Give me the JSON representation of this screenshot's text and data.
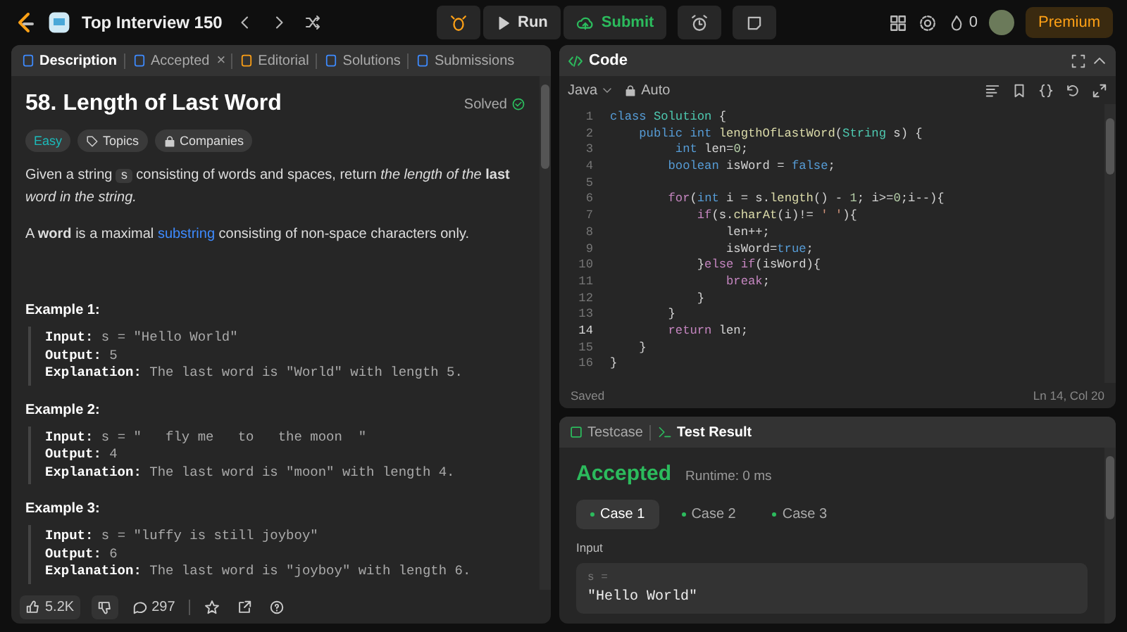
{
  "top_bar": {
    "list_title": "Top Interview 150",
    "run": "Run",
    "submit": "Submit",
    "streak": "0",
    "premium": "Premium"
  },
  "description_panel": {
    "tabs": [
      {
        "label": "Description",
        "selected": true
      },
      {
        "label": "Accepted",
        "selected": false,
        "close": "×"
      },
      {
        "label": "Editorial",
        "selected": false
      },
      {
        "label": "Solutions",
        "selected": false
      },
      {
        "label": "Submissions",
        "selected": false
      }
    ],
    "title": "58. Length of Last Word",
    "status": "Solved",
    "difficulty": "Easy",
    "tags": [
      "Topics",
      "Companies"
    ],
    "paragraph_1": {
      "before": "Given a string",
      "code": "s",
      "after": "consisting of words and spaces, return *the length of the* **last** *word in the string.*"
    },
    "paragraph_2": {
      "before": "A **word** is a maximal",
      "link": "substring",
      "after": "consisting of non-space characters only."
    },
    "examples": [
      {
        "title": "Example 1:",
        "lines": [
          {
            "label": "Input:",
            "value": "s = \"Hello World\""
          },
          {
            "label": "Output:",
            "value": "5"
          },
          {
            "label": "Explanation:",
            "value": "The last word is \"World\" with length 5."
          }
        ]
      },
      {
        "title": "Example 2:",
        "lines": [
          {
            "label": "Input:",
            "value": "s = \"   fly me   to   the moon  \""
          },
          {
            "label": "Output:",
            "value": "4"
          },
          {
            "label": "Explanation:",
            "value": "The last word is \"moon\" with length 4."
          }
        ]
      },
      {
        "title": "Example 3:",
        "lines": [
          {
            "label": "Input:",
            "value": "s = \"luffy is still joyboy\""
          },
          {
            "label": "Output:",
            "value": "6"
          },
          {
            "label": "Explanation:",
            "value": "The last word is \"joyboy\" with length 6."
          }
        ]
      }
    ],
    "footer": {
      "likes": "5.2K",
      "comments": "297"
    }
  },
  "code_panel": {
    "title": "Code",
    "language": "Java",
    "mode": "Auto",
    "status": "Saved",
    "cursor": "Ln 14, Col 20",
    "lines": [
      {
        "number": "1",
        "tokens": [
          {
            "kind": "decl",
            "text": "class "
          },
          {
            "kind": "type",
            "text": "Solution"
          },
          {
            "kind": "plain",
            "text": " {"
          }
        ]
      },
      {
        "number": "2",
        "tokens": [
          {
            "kind": "decl",
            "text": "    public int "
          },
          {
            "kind": "fn",
            "text": "lengthOfLastWord"
          },
          {
            "kind": "plain",
            "text": "("
          },
          {
            "kind": "type",
            "text": "String"
          },
          {
            "kind": "plain",
            "text": " s) {"
          }
        ]
      },
      {
        "number": "3",
        "tokens": [
          {
            "kind": "decl",
            "text": "         int "
          },
          {
            "kind": "plain",
            "text": "len="
          },
          {
            "kind": "num",
            "text": "0"
          },
          {
            "kind": "plain",
            "text": ";"
          }
        ]
      },
      {
        "number": "4",
        "tokens": [
          {
            "kind": "decl",
            "text": "        boolean "
          },
          {
            "kind": "plain",
            "text": "isWord = "
          },
          {
            "kind": "decl",
            "text": "false"
          },
          {
            "kind": "plain",
            "text": ";"
          }
        ]
      },
      {
        "number": "5"
      },
      {
        "number": "6",
        "tokens": [
          {
            "kind": "ctrl",
            "text": "        for"
          },
          {
            "kind": "plain",
            "text": "("
          },
          {
            "kind": "decl",
            "text": "int "
          },
          {
            "kind": "plain",
            "text": "i = s."
          },
          {
            "kind": "fn",
            "text": "length"
          },
          {
            "kind": "plain",
            "text": "() - "
          },
          {
            "kind": "num",
            "text": "1"
          },
          {
            "kind": "plain",
            "text": "; i>="
          },
          {
            "kind": "num",
            "text": "0"
          },
          {
            "kind": "plain",
            "text": ";i--){"
          }
        ]
      },
      {
        "number": "7",
        "tokens": [
          {
            "kind": "ctrl",
            "text": "            if"
          },
          {
            "kind": "plain",
            "text": "(s."
          },
          {
            "kind": "fn",
            "text": "charAt"
          },
          {
            "kind": "plain",
            "text": "(i)!= "
          },
          {
            "kind": "str",
            "text": "' '"
          },
          {
            "kind": "plain",
            "text": "){"
          }
        ]
      },
      {
        "number": "8",
        "tokens": [
          {
            "kind": "plain",
            "text": "                len++;"
          }
        ]
      },
      {
        "number": "9",
        "tokens": [
          {
            "kind": "plain",
            "text": "                isWord="
          },
          {
            "kind": "decl",
            "text": "true"
          },
          {
            "kind": "plain",
            "text": ";"
          }
        ]
      },
      {
        "number": "10",
        "tokens": [
          {
            "kind": "plain",
            "text": "            }"
          },
          {
            "kind": "ctrl",
            "text": "else if"
          },
          {
            "kind": "plain",
            "text": "(isWord){"
          }
        ]
      },
      {
        "number": "11",
        "tokens": [
          {
            "kind": "ctrl",
            "text": "                break"
          },
          {
            "kind": "plain",
            "text": ";"
          }
        ]
      },
      {
        "number": "12",
        "tokens": [
          {
            "kind": "plain",
            "text": "            }"
          }
        ]
      },
      {
        "number": "13",
        "tokens": [
          {
            "kind": "plain",
            "text": "        }"
          }
        ]
      },
      {
        "number": "14",
        "tokens": [
          {
            "kind": "ctrl",
            "text": "        return"
          },
          {
            "kind": "plain",
            "text": " len;"
          }
        ]
      },
      {
        "number": "15",
        "tokens": [
          {
            "kind": "plain",
            "text": "    }"
          }
        ]
      },
      {
        "number": "16",
        "tokens": [
          {
            "kind": "plain",
            "text": "}"
          }
        ]
      }
    ]
  },
  "result_panel": {
    "tabs": [
      {
        "label": "Testcase",
        "selected": false
      },
      {
        "label": "Test Result",
        "selected": true
      }
    ],
    "verdict": "Accepted",
    "runtime": "Runtime: 0 ms",
    "cases": [
      {
        "label": "Case 1",
        "selected": true
      },
      {
        "label": "Case 2",
        "selected": false
      },
      {
        "label": "Case 3",
        "selected": false
      }
    ],
    "input_label": "Input",
    "variable": "s =",
    "value": "\"Hello World\""
  }
}
